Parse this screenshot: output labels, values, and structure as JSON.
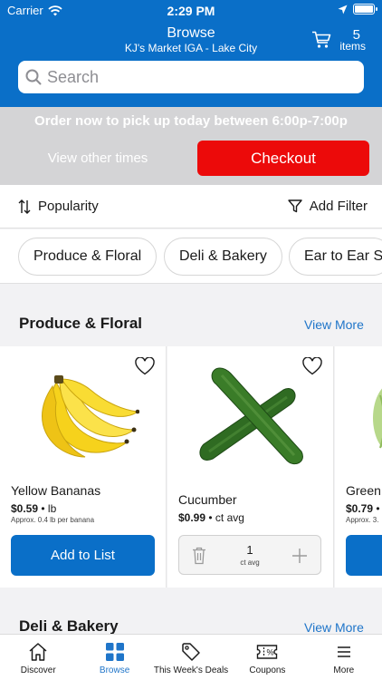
{
  "status_bar": {
    "carrier": "Carrier",
    "time": "2:29 PM",
    "battery_level": 1.0
  },
  "header": {
    "title": "Browse",
    "store": "KJ's Market IGA - Lake City",
    "cart_count": "5",
    "cart_unit": "items"
  },
  "search": {
    "placeholder": "Search"
  },
  "pickup": {
    "message": "Order now to pick up today between 6:00p-7:00p",
    "other_times": "View other times",
    "checkout": "Checkout"
  },
  "sort": {
    "label": "Popularity"
  },
  "filter": {
    "label": "Add Filter"
  },
  "categories": [
    "Produce & Floral",
    "Deli & Bakery",
    "Ear to Ear Sa"
  ],
  "sections": [
    {
      "title": "Produce & Floral",
      "view_more": "View More",
      "products": [
        {
          "name": "Yellow Bananas",
          "price": "$0.59",
          "unit": "lb",
          "approx": "Approx. 0.4 lb per banana",
          "action": "Add to List"
        },
        {
          "name": "Cucumber",
          "price": "$0.99",
          "unit": "ct avg",
          "qty": "1",
          "qty_unit": "ct avg"
        },
        {
          "name": "Green",
          "price": "$0.79",
          "approx": "Approx. 3."
        }
      ]
    },
    {
      "title": "Deli & Bakery",
      "view_more": "View More"
    }
  ],
  "separator": "•",
  "tabs": [
    {
      "label": "Discover",
      "icon": "home-icon"
    },
    {
      "label": "Browse",
      "icon": "grid-icon",
      "active": true
    },
    {
      "label": "This Week's Deals",
      "icon": "tag-icon"
    },
    {
      "label": "Coupons",
      "icon": "coupon-icon"
    },
    {
      "label": "More",
      "icon": "menu-icon"
    }
  ],
  "colors": {
    "brand": "#0a6fc8",
    "checkout": "#ec0a0a",
    "link": "#1f75c9"
  }
}
